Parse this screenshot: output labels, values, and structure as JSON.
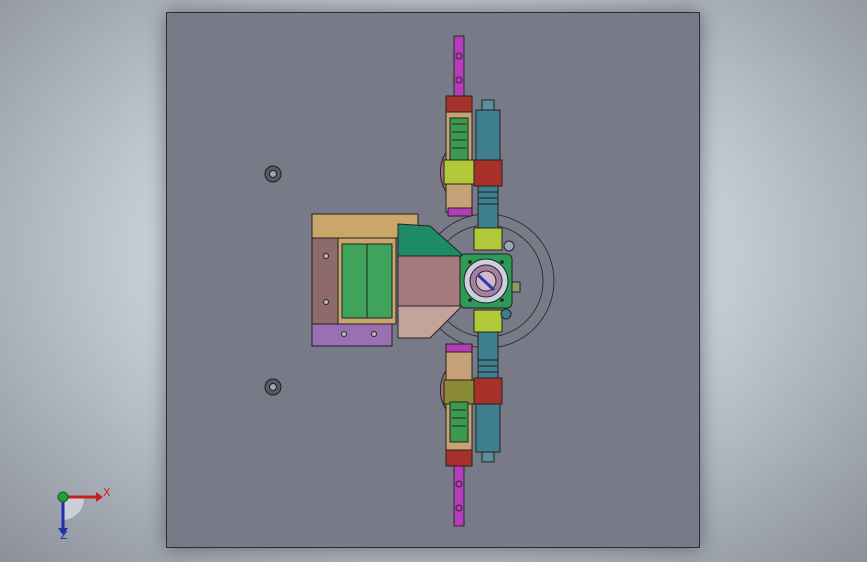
{
  "triad": {
    "x_label": "X",
    "z_label": "Z",
    "x_color": "#c8201f",
    "y_color": "#22a033",
    "z_color": "#1f2fb0"
  },
  "colors": {
    "plate": "#787b87",
    "edges": "#2a2a2a",
    "magenta": "#b43cb8",
    "red": "#a8302a",
    "beige": "#c7a277",
    "green": "#32a05a",
    "lime": "#b4c93a",
    "steel_blue": "#3f7f90",
    "tan": "#c9a76a",
    "mauve": "#a57a7f",
    "teal": "#1f8a66",
    "violet": "#9a6fb3"
  }
}
